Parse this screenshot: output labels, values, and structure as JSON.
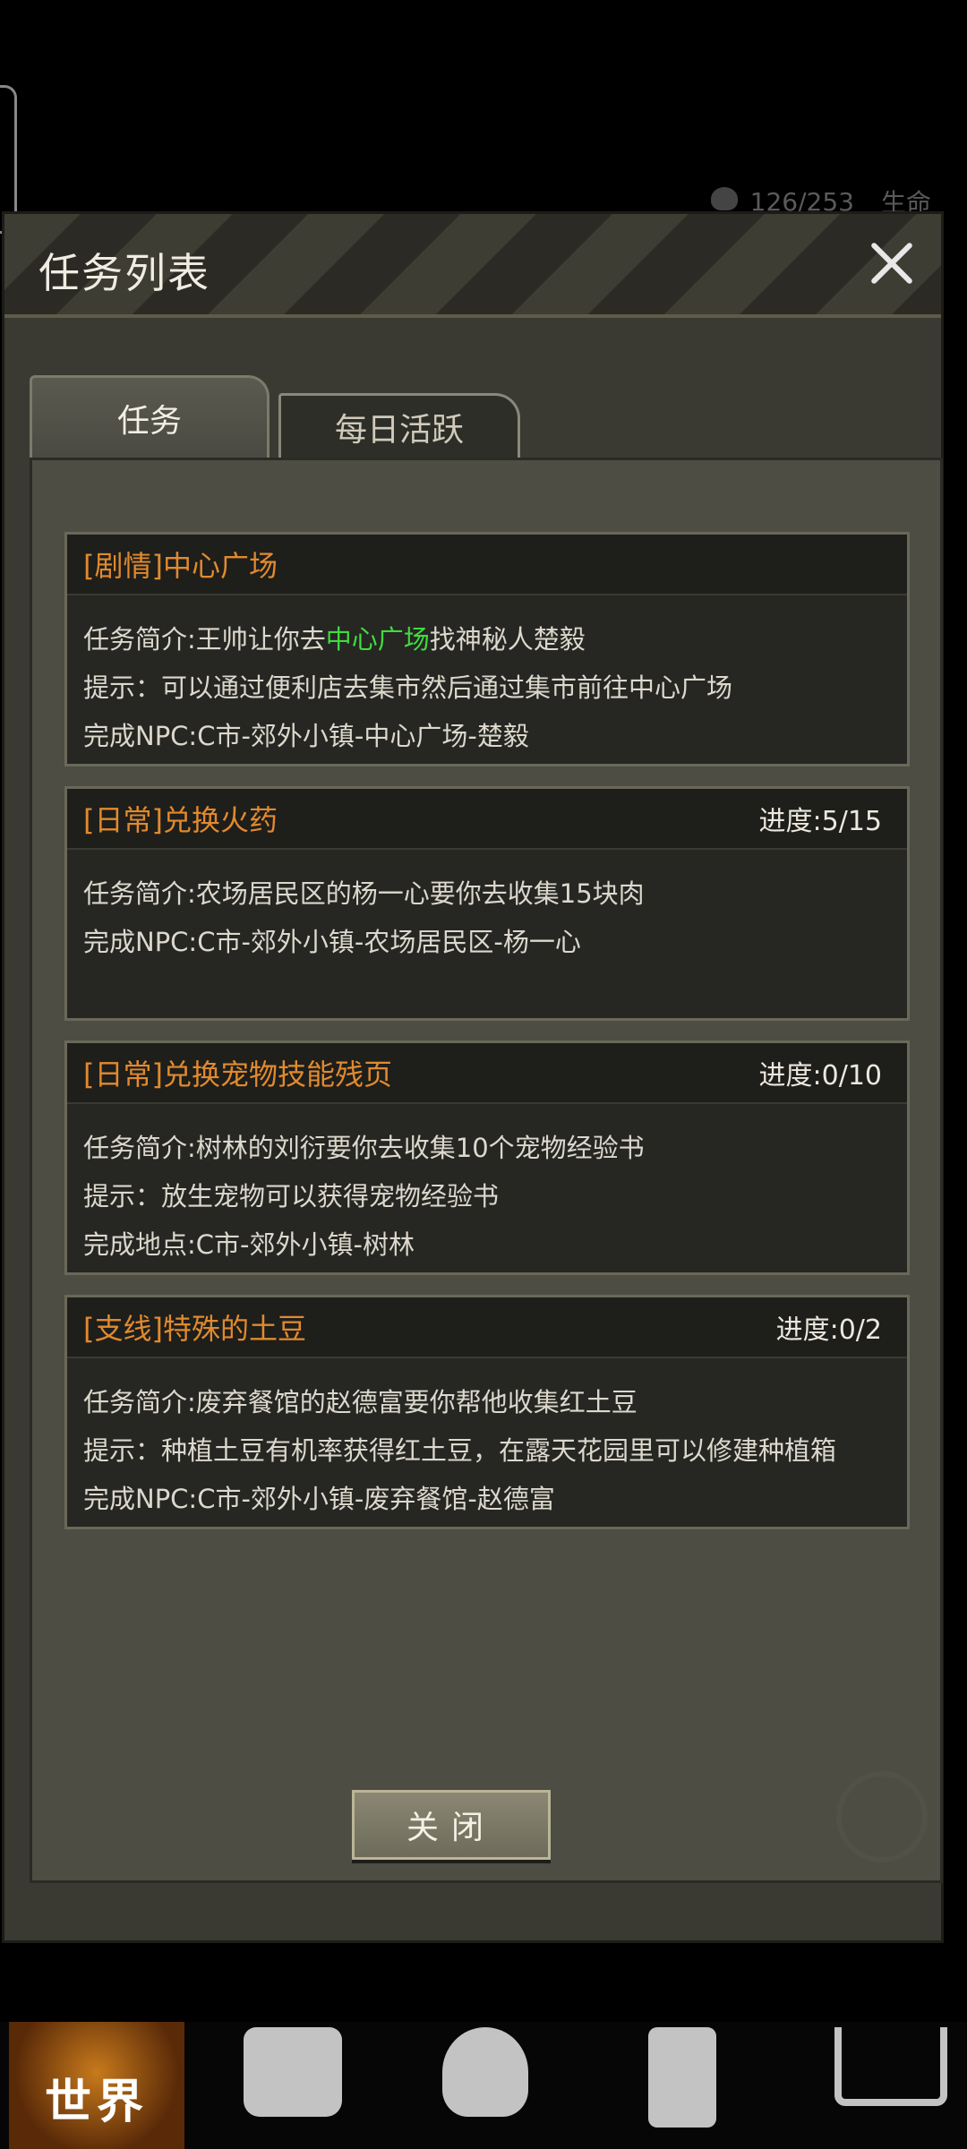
{
  "background": {
    "stat_value": "126/253",
    "stat_label": "生命"
  },
  "dialog": {
    "title": "任务列表",
    "close_icon": "close-x-icon"
  },
  "tabs": [
    {
      "label": "任务",
      "active": true
    },
    {
      "label": "每日活跃",
      "active": false
    }
  ],
  "quests": [
    {
      "title": "[剧情]中心广场",
      "progress": "",
      "summary_prefix": "任务简介:王帅让你去",
      "summary_highlight": "中心广场",
      "summary_suffix": "找神秘人楚毅",
      "hint": "提示：可以通过便利店去集市然后通过集市前往中心广场",
      "complete": "完成NPC:C市-郊外小镇-中心广场-楚毅"
    },
    {
      "title": "[日常]兑换火药",
      "progress": "进度:5/15",
      "summary": "任务简介:农场居民区的杨一心要你去收集15块肉",
      "complete": "完成NPC:C市-郊外小镇-农场居民区-杨一心"
    },
    {
      "title": "[日常]兑换宠物技能残页",
      "progress": "进度:0/10",
      "summary": "任务简介:树林的刘衍要你去收集10个宠物经验书",
      "hint": "提示：放生宠物可以获得宠物经验书",
      "complete": "完成地点:C市-郊外小镇-树林"
    },
    {
      "title": "[支线]特殊的土豆",
      "progress": "进度:0/2",
      "summary": "任务简介:废弃餐馆的赵德富要你帮他收集红土豆",
      "hint": "提示：种植土豆有机率获得红土豆，在露天花园里可以修建种植箱",
      "complete": "完成NPC:C市-郊外小镇-废弃餐馆-赵德富"
    }
  ],
  "close_button": "关闭",
  "bottom_nav": {
    "world": "世界",
    "icons": [
      "backpack-icon",
      "character-head-icon",
      "phone-icon",
      "cart-icon"
    ]
  },
  "colors": {
    "quest_title": "#e08a2e",
    "highlight": "#3fdc3f",
    "panel": "#4d4d44"
  }
}
